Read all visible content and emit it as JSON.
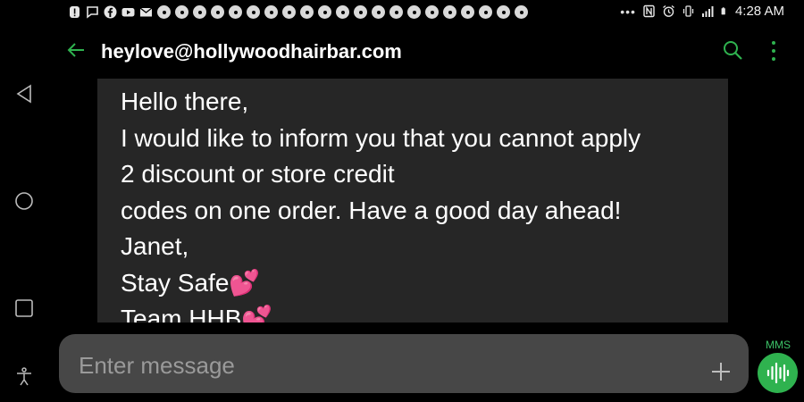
{
  "status_bar": {
    "time": "4:28 AM",
    "overflow": "•••",
    "notification_icons": [
      "alert-icon",
      "chat-icon",
      "facebook-icon",
      "youtube-icon",
      "mail-icon"
    ],
    "chrome_icon_count": 21
  },
  "header": {
    "contact": "heylove@hollywoodhairbar.com"
  },
  "message": {
    "lines": [
      "Hello there,",
      "I would like to inform you that you cannot apply",
      "2 discount or store credit",
      "codes on one order. Have a good day ahead!",
      "Janet,",
      "Stay Safe💕",
      "Team HHB💕"
    ]
  },
  "composer": {
    "placeholder": "Enter message",
    "mms_label": "MMS"
  },
  "colors": {
    "accent": "#2fb24f",
    "bubble": "#262626",
    "composer": "#474747"
  }
}
